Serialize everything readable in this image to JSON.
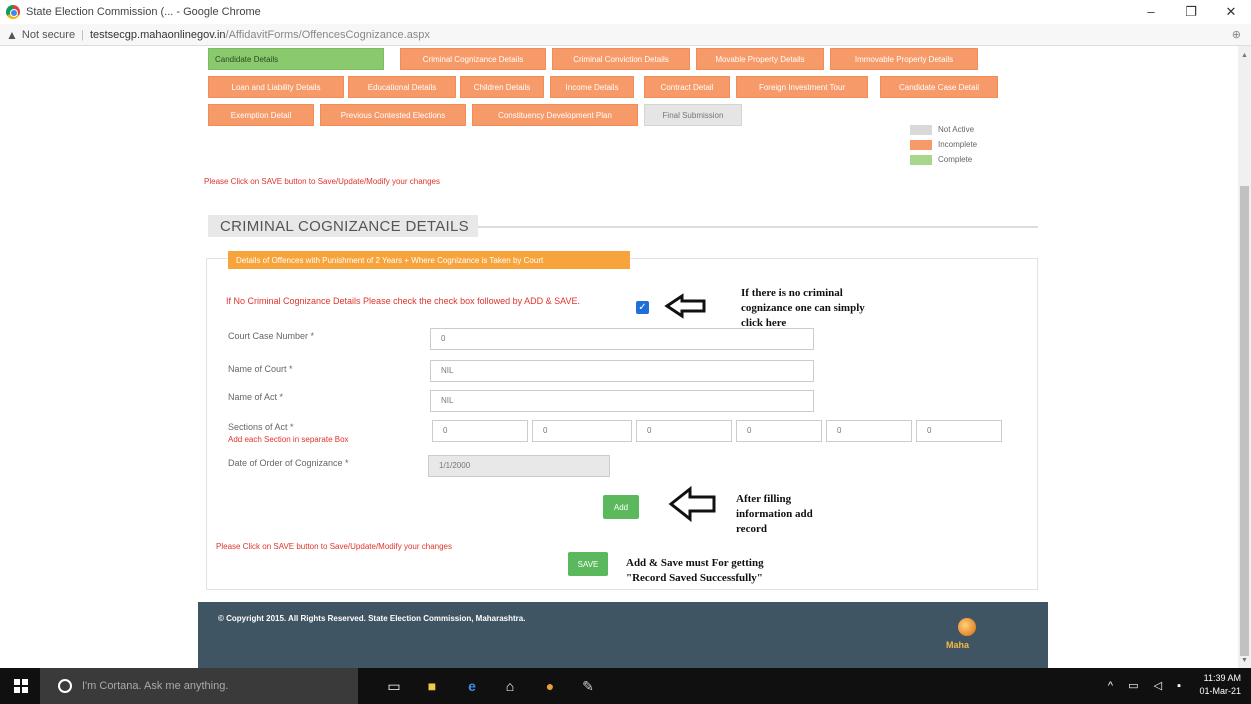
{
  "window": {
    "title": "State Election Commission (... - Google Chrome",
    "url_prefix": "Not secure",
    "url_host": "testsecgp.mahaonlinegov.in",
    "url_path": "/AffidavitForms/OffencesCognizance.aspx"
  },
  "tabs": {
    "row1": [
      "Candidate Details",
      "Criminal Cognizance Details",
      "Criminal Conviction Details",
      "Movable Property Details",
      "Immovable Property Details"
    ],
    "row2": [
      "Loan and Liability Details",
      "Educational Details",
      "Children Details",
      "Income Details",
      "Contract Detail",
      "Foreign Investment Tour",
      "Candidate Case Detail"
    ],
    "row3": [
      "Exemption Detail",
      "Previous Contested Elections",
      "Constituency Development Plan",
      "Final Submission"
    ]
  },
  "legend": [
    {
      "label": "Not Active",
      "color": "#d9d9d9"
    },
    {
      "label": "Incomplete",
      "color": "#f79a69"
    },
    {
      "label": "Complete",
      "color": "#a8d68a"
    }
  ],
  "notice_top": "Please Click on SAVE button to Save/Update/Modify your changes",
  "section_title": "CRIMINAL COGNIZANCE DETAILS",
  "offence_header": "Details of Offences with Punishment of 2 Years + Where Cognizance is Taken by Court",
  "form": {
    "checkbox_label": "If No Criminal Cognizance Details Please check the check box followed by ADD & SAVE.",
    "court_case_label": "Court Case Number *",
    "court_case_value": "0",
    "court_name_label": "Name of Court *",
    "court_name_value": "NIL",
    "act_name_label": "Name of Act *",
    "act_name_value": "NIL",
    "sections_label": "Sections of Act *",
    "sections_hint": "Add each Section in separate Box",
    "sections_values": [
      "0",
      "0",
      "0",
      "0",
      "0",
      "0"
    ],
    "date_label": "Date of Order of Cognizance *",
    "date_value": "1/1/2000",
    "add_label": "Add",
    "save_label": "SAVE"
  },
  "notice_bottom": "Please Click on SAVE button to Save/Update/Modify your changes",
  "annotations": {
    "checkbox_note": [
      "If there is no criminal",
      "cognizance one can simply",
      "click here"
    ],
    "add_note": [
      "After filling",
      "information add",
      "record"
    ],
    "save_note": [
      "Add & Save must For getting",
      "\"Record Saved Successfully\""
    ]
  },
  "footer": {
    "copyright": "© Copyright 2015. All Rights Reserved. State Election Commission, Maharashtra.",
    "logo_text": "Maha"
  },
  "taskbar": {
    "search_placeholder": "I'm Cortana. Ask me anything.",
    "time": "11:39 AM",
    "date": "01-Mar-21"
  }
}
